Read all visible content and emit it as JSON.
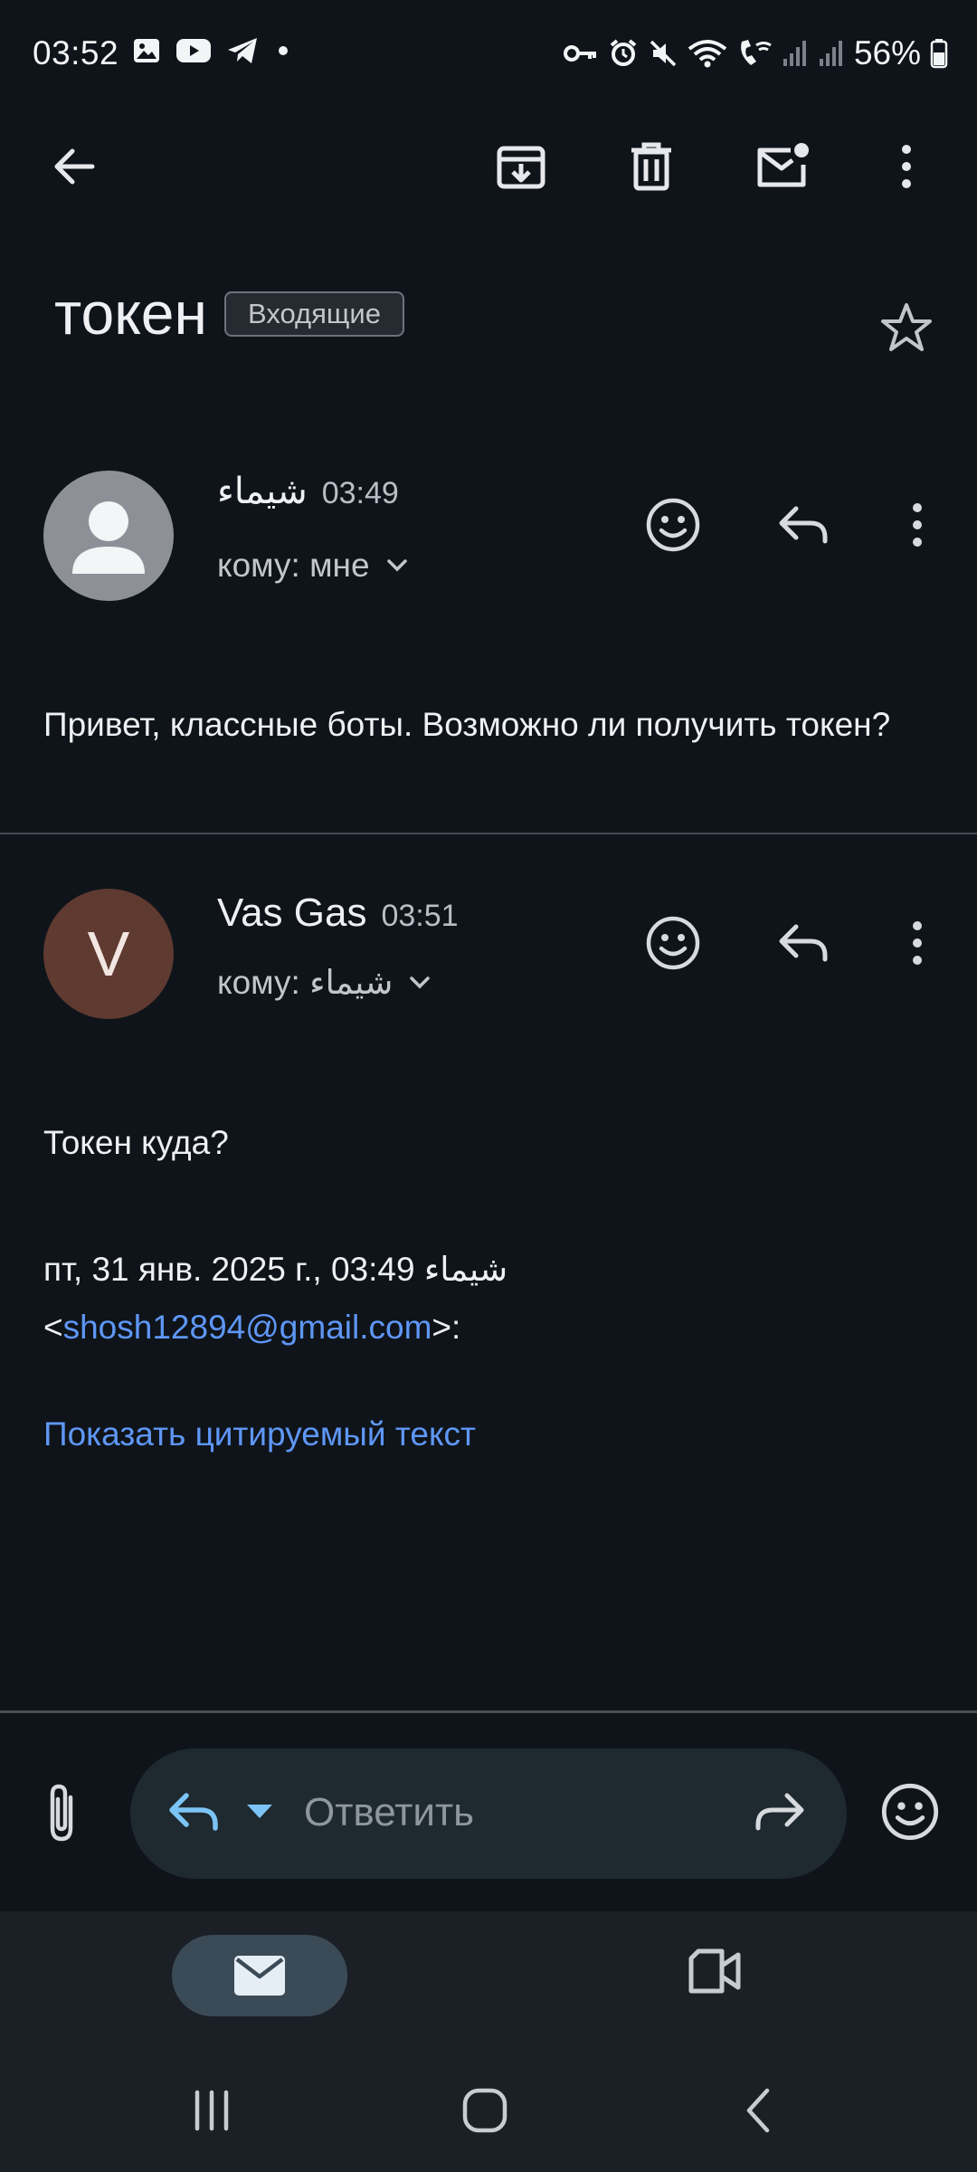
{
  "status_bar": {
    "time": "03:52",
    "battery": "56%",
    "left_icons": [
      "gallery-icon",
      "youtube-icon",
      "telegram-icon",
      "dot-icon"
    ],
    "right_icons": [
      "key-icon",
      "alarm-icon",
      "mute-icon",
      "wifi-icon",
      "wifi-calling-icon",
      "signal-icon",
      "signal-icon",
      "battery-icon"
    ]
  },
  "toolbar": {
    "icons": [
      "back-arrow-icon",
      "archive-icon",
      "delete-icon",
      "mark-unread-icon",
      "more-vertical-icon"
    ]
  },
  "email": {
    "subject": "токен",
    "label": "Входящие"
  },
  "messages": [
    {
      "sender": "شيماء",
      "time": "03:49",
      "recipient": "кому: мне",
      "body": "Привет, классные боты. Возможно ли получить токен?"
    },
    {
      "avatar_letter": "V",
      "sender": "Vas Gas",
      "time": "03:51",
      "recipient": "кому: شيماء",
      "body": "Токен куда?",
      "quote_header": "пт, 31 янв. 2025 г., 03:49 شيماء",
      "quote_lt": "<",
      "quote_email": "shosh12894@gmail.com",
      "quote_gt": ">:",
      "show_quoted": "Показать цитируемый текст"
    }
  ],
  "reply_bar": {
    "placeholder": "Ответить"
  },
  "colors": {
    "background": "#0f141a",
    "link": "#5e97f6",
    "reply_accent": "#7cc4f5",
    "avatar_v": "#5f3a30"
  }
}
